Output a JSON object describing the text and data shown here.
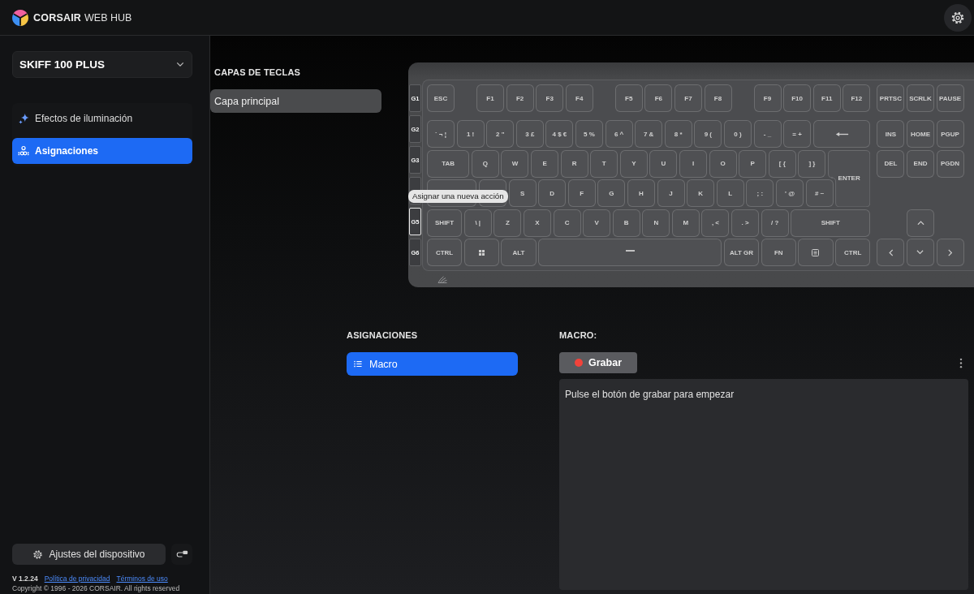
{
  "header": {
    "brand": "CORSAIR",
    "product": "WEB HUB"
  },
  "sidebar": {
    "device": "SKIFF 100 PLUS",
    "nav": [
      {
        "label": "Efectos de iluminación",
        "kind": "lighting",
        "selected": false
      },
      {
        "label": "Asignaciones",
        "kind": "assignments",
        "selected": true
      }
    ],
    "settings_button": "Ajustes del dispositivo",
    "version": "V 1.2.24",
    "links": [
      "Política de privacidad",
      "Términos de uso"
    ],
    "copyright": "Copyright © 1996 - 2026 CORSAIR. All rights reserved"
  },
  "layers": {
    "title": "CAPAS DE TECLAS",
    "items": [
      {
        "label": "Capa principal",
        "selected": true
      }
    ]
  },
  "keyboard": {
    "g_keys": [
      {
        "label": "G1",
        "selected": false
      },
      {
        "label": "G2",
        "selected": false
      },
      {
        "label": "G3",
        "selected": false
      },
      {
        "selected": false
      },
      {
        "label": "G5",
        "selected": true
      },
      {
        "label": "G6",
        "selected": false
      }
    ],
    "key_rows": [
      {
        "keys": [
          {
            "kind": "key",
            "label": "ESC"
          },
          {
            "kind": "key",
            "label": "F1"
          },
          {
            "kind": "key",
            "label": "F2"
          },
          {
            "kind": "key",
            "label": "F3"
          },
          {
            "kind": "key",
            "label": "F4"
          },
          {
            "kind": "key",
            "label": "F5"
          },
          {
            "kind": "key",
            "label": "F6"
          },
          {
            "kind": "key",
            "label": "F7"
          },
          {
            "kind": "key",
            "label": "F8"
          },
          {
            "kind": "key",
            "label": "F9"
          },
          {
            "kind": "key",
            "label": "F10"
          },
          {
            "kind": "key",
            "label": "F11"
          },
          {
            "kind": "key",
            "label": "F12"
          },
          {
            "kind": "key",
            "label": "PRTSC"
          },
          {
            "kind": "key",
            "label": "SCRLK"
          },
          {
            "kind": "key",
            "label": "PAUSE"
          }
        ]
      },
      {
        "keys": [
          {
            "kind": "key",
            "label": "` ¬ ¦"
          },
          {
            "kind": "key",
            "label": "1 !"
          },
          {
            "kind": "key",
            "label": "2 \""
          },
          {
            "kind": "key",
            "label": "3 £"
          },
          {
            "kind": "key",
            "label": "4 $ €"
          },
          {
            "kind": "key",
            "label": "5 %"
          },
          {
            "kind": "key",
            "label": "6 ^"
          },
          {
            "kind": "key",
            "label": "7 &"
          },
          {
            "kind": "key",
            "label": "8 *"
          },
          {
            "kind": "key",
            "label": "9 ("
          },
          {
            "kind": "key",
            "label": "0 )"
          },
          {
            "kind": "key",
            "label": "- _"
          },
          {
            "kind": "key",
            "label": "= +"
          },
          {
            "kind": "backspace"
          },
          {
            "kind": "key",
            "label": "INS"
          },
          {
            "kind": "key",
            "label": "HOME"
          },
          {
            "kind": "key",
            "label": "PGUP"
          }
        ]
      },
      {
        "keys": [
          {
            "kind": "key",
            "label": "TAB"
          },
          {
            "kind": "key",
            "label": "Q"
          },
          {
            "kind": "key",
            "label": "W"
          },
          {
            "kind": "key",
            "label": "E"
          },
          {
            "kind": "key",
            "label": "R"
          },
          {
            "kind": "key",
            "label": "T"
          },
          {
            "kind": "key",
            "label": "Y"
          },
          {
            "kind": "key",
            "label": "U"
          },
          {
            "kind": "key",
            "label": "I"
          },
          {
            "kind": "key",
            "label": "O"
          },
          {
            "kind": "key",
            "label": "P"
          },
          {
            "kind": "key",
            "label": "[ {"
          },
          {
            "kind": "key",
            "label": "] }"
          },
          {
            "kind": "enter",
            "label": "ENTER"
          },
          {
            "kind": "key",
            "label": "DEL"
          },
          {
            "kind": "key",
            "label": "END"
          },
          {
            "kind": "key",
            "label": "PGDN"
          }
        ]
      },
      {
        "keys": [
          {
            "kind": "key"
          },
          {
            "kind": "key"
          },
          {
            "kind": "key",
            "label": "S"
          },
          {
            "kind": "key",
            "label": "D"
          },
          {
            "kind": "key",
            "label": "F"
          },
          {
            "kind": "key",
            "label": "G"
          },
          {
            "kind": "key",
            "label": "H"
          },
          {
            "kind": "key",
            "label": "J"
          },
          {
            "kind": "key",
            "label": "K"
          },
          {
            "kind": "key",
            "label": "L"
          },
          {
            "kind": "key",
            "label": "; :"
          },
          {
            "kind": "key",
            "label": "' @"
          },
          {
            "kind": "key",
            "label": "# ~"
          }
        ]
      },
      {
        "keys": [
          {
            "kind": "key",
            "label": "SHIFT"
          },
          {
            "kind": "key",
            "label": "\\ |"
          },
          {
            "kind": "key",
            "label": "Z"
          },
          {
            "kind": "key",
            "label": "X"
          },
          {
            "kind": "key",
            "label": "C"
          },
          {
            "kind": "key",
            "label": "V"
          },
          {
            "kind": "key",
            "label": "B"
          },
          {
            "kind": "key",
            "label": "N"
          },
          {
            "kind": "key",
            "label": "M"
          },
          {
            "kind": "key",
            "label": ", <"
          },
          {
            "kind": "key",
            "label": ". >"
          },
          {
            "kind": "key",
            "label": "/ ?"
          },
          {
            "kind": "key",
            "label": "SHIFT"
          },
          {
            "kind": "up"
          }
        ]
      },
      {
        "keys": [
          {
            "kind": "key",
            "label": "CTRL"
          },
          {
            "kind": "windows"
          },
          {
            "kind": "key",
            "label": "ALT"
          },
          {
            "kind": "space"
          },
          {
            "kind": "key",
            "label": "ALT GR"
          },
          {
            "kind": "key",
            "label": "FN"
          },
          {
            "kind": "menu"
          },
          {
            "kind": "key",
            "label": "CTRL"
          },
          {
            "kind": "left"
          },
          {
            "kind": "down"
          },
          {
            "kind": "right"
          }
        ]
      }
    ],
    "tooltip": "Asignar una nueva acción"
  },
  "assignments": {
    "title": "ASIGNACIONES",
    "items": [
      {
        "label": "Macro",
        "selected": true
      }
    ]
  },
  "macro": {
    "title": "MACRO:",
    "record_button": "Grabar",
    "hint": "Pulse el botón de grabar para empezar"
  }
}
